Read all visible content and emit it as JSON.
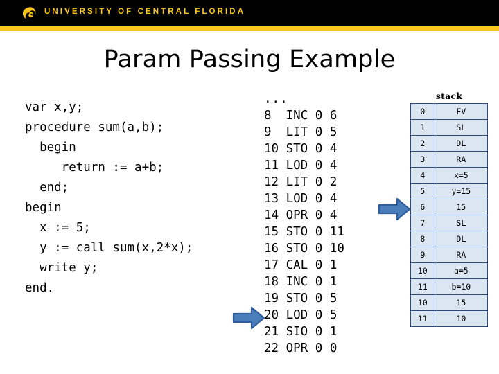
{
  "header": {
    "wordmark": "UNIVERSITY OF CENTRAL FLORIDA",
    "logo_icon": "ucf-pegasus-icon",
    "background_color": "#000000",
    "accent_color": "#fbc81e",
    "text_color": "#f6c51c"
  },
  "slide": {
    "title": "Param Passing Example"
  },
  "source_code": {
    "lines": [
      "var x,y;",
      "procedure sum(a,b);",
      "  begin",
      "     return := a+b;",
      "  end;",
      "begin",
      "  x := 5;",
      "  y := call sum(x,2*x);",
      "  write y;",
      "end."
    ]
  },
  "instruction_listing": {
    "ellipsis": "...",
    "lines": [
      "8  INC 0 6",
      "9  LIT 0 5",
      "10 STO 0 4",
      "11 LOD 0 4",
      "12 LIT 0 2",
      "13 LOD 0 4",
      "14 OPR 0 4",
      "15 STO 0 11",
      "16 STO 0 10",
      "17 CAL 0 1",
      "18 INC 0 1",
      "19 STO 0 5",
      "20 LOD 0 5",
      "21 SIO 0 1",
      "22 OPR 0 0"
    ]
  },
  "arrows": [
    {
      "name": "arrow-to-stack",
      "direction": "right",
      "color": "#4a7ebb",
      "border_color": "#2f5e9e"
    },
    {
      "name": "arrow-to-instruction",
      "direction": "right",
      "color": "#4a7ebb",
      "border_color": "#2f5e9e"
    }
  ],
  "stack": {
    "caption": "stack",
    "cell_background": "#dce6f2",
    "border_color": "#2a4a7b",
    "rows": [
      {
        "index": "0",
        "value": "FV"
      },
      {
        "index": "1",
        "value": "SL"
      },
      {
        "index": "2",
        "value": "DL"
      },
      {
        "index": "3",
        "value": "RA"
      },
      {
        "index": "4",
        "value": "x=5"
      },
      {
        "index": "5",
        "value": "y=15"
      },
      {
        "index": "6",
        "value": "15"
      },
      {
        "index": "7",
        "value": "SL"
      },
      {
        "index": "8",
        "value": "DL"
      },
      {
        "index": "9",
        "value": "RA"
      },
      {
        "index": "10",
        "value": "a=5"
      },
      {
        "index": "11",
        "value": "b=10"
      },
      {
        "index": "10",
        "value": "15"
      },
      {
        "index": "11",
        "value": "10"
      }
    ]
  }
}
